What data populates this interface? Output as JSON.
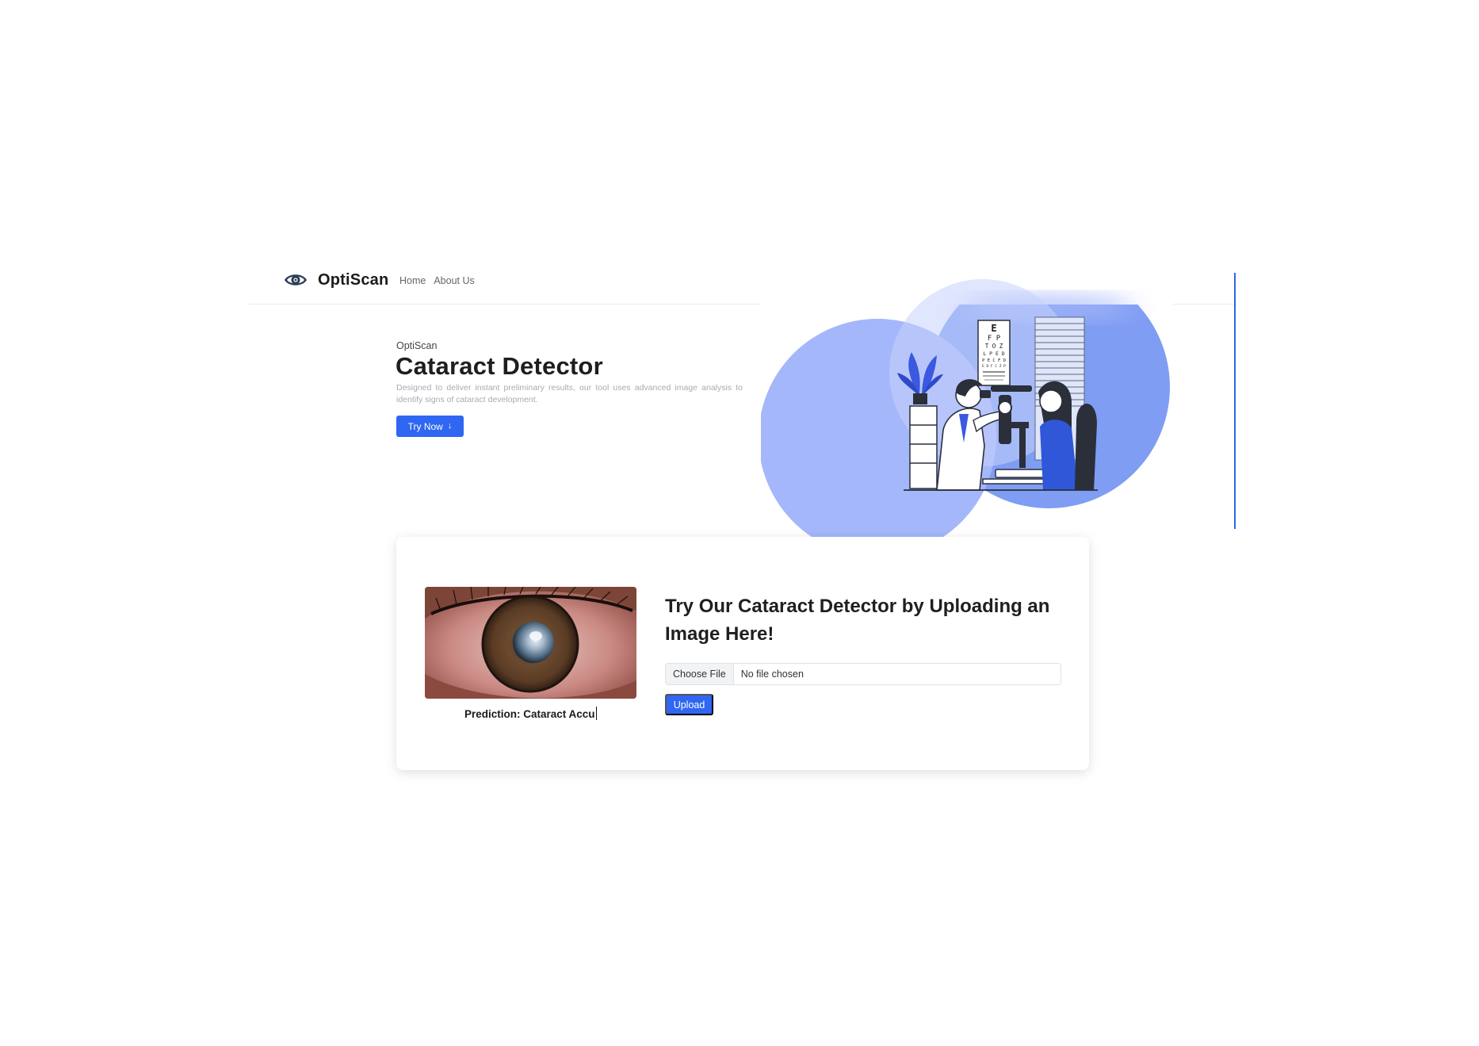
{
  "navbar": {
    "brand": {
      "name": "OptiScan",
      "icon": "eye-logo-icon"
    },
    "links": [
      {
        "label": "Home"
      },
      {
        "label": "About Us"
      }
    ]
  },
  "hero": {
    "kicker": "OptiScan",
    "title": "Cataract Detector",
    "description": "Designed to deliver instant preliminary results, our tool uses advanced image analysis to identify signs of cataract development.",
    "cta": {
      "label": "Try Now",
      "icon": "arrow-down-icon"
    },
    "illustration": {
      "eye_chart_rows": [
        "E",
        "F P",
        "T O Z",
        "L P E D",
        "P E C F D",
        "E D F C Z P"
      ]
    }
  },
  "upload": {
    "heading": "Try Our Cataract Detector by Uploading an Image Here!",
    "file_input": {
      "button_label": "Choose File",
      "status": "No file chosen"
    },
    "upload_label": "Upload",
    "prediction_text": "Prediction: Cataract Accu"
  },
  "colors": {
    "primary": "#2f66f2",
    "blob_light": "#a4b7fb",
    "blob_mid": "#7f9df2",
    "text_dark": "#1e1e1e"
  }
}
